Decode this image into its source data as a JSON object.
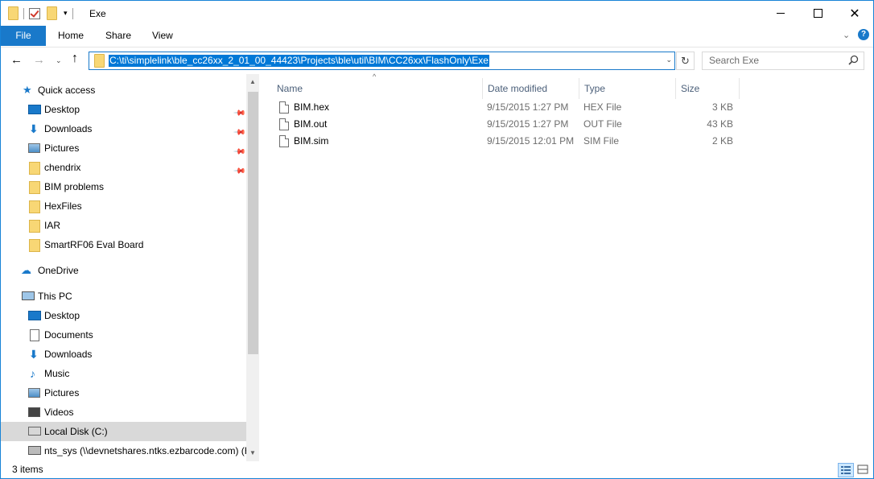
{
  "window": {
    "title": "Exe",
    "qa_dropdown": "▾",
    "min_label": "",
    "close_label": "✕"
  },
  "ribbon": {
    "tabs": [
      {
        "label": "File"
      },
      {
        "label": "Home"
      },
      {
        "label": "Share"
      },
      {
        "label": "View"
      }
    ],
    "collapse_glyph": "⌄",
    "help_glyph": "?"
  },
  "address": {
    "back_glyph": "←",
    "forward_glyph": "→",
    "recent_glyph": "⌄",
    "up_glyph": "↑",
    "path": "C:\\ti\\simplelink\\ble_cc26xx_2_01_00_44423\\Projects\\ble\\util\\BIM\\CC26xx\\FlashOnly\\Exe",
    "dropdown_glyph": "⌄",
    "refresh_glyph": "↻"
  },
  "search": {
    "placeholder": "Search Exe"
  },
  "nav": {
    "pin_glyph": "📌",
    "scroll_up": "▲",
    "scroll_down": "▼",
    "items": [
      {
        "label": "Quick access",
        "icon": "star-icon"
      },
      {
        "label": "Desktop",
        "icon": "desktop-icon",
        "pinned": true
      },
      {
        "label": "Downloads",
        "icon": "download-icon",
        "pinned": true
      },
      {
        "label": "Pictures",
        "icon": "pictures-icon",
        "pinned": true
      },
      {
        "label": "chendrix",
        "icon": "folder-icon",
        "pinned": true
      },
      {
        "label": "BIM problems",
        "icon": "folder-icon"
      },
      {
        "label": "HexFiles",
        "icon": "folder-icon"
      },
      {
        "label": "IAR",
        "icon": "folder-icon"
      },
      {
        "label": "SmartRF06 Eval Board",
        "icon": "folder-icon"
      },
      {
        "label": "OneDrive",
        "icon": "cloud-icon"
      },
      {
        "label": "This PC",
        "icon": "computer-icon"
      },
      {
        "label": "Desktop",
        "icon": "desktop-icon"
      },
      {
        "label": "Documents",
        "icon": "documents-icon"
      },
      {
        "label": "Downloads",
        "icon": "download-icon"
      },
      {
        "label": "Music",
        "icon": "music-icon"
      },
      {
        "label": "Pictures",
        "icon": "pictures-icon"
      },
      {
        "label": "Videos",
        "icon": "videos-icon"
      },
      {
        "label": "Local Disk (C:)",
        "icon": "disk-icon",
        "selected": true
      },
      {
        "label": "nts_sys (\\\\devnetshares.ntks.ezbarcode.com) (H",
        "icon": "network-drive-icon"
      }
    ]
  },
  "files": {
    "sort_glyph": "^",
    "columns": {
      "name": "Name",
      "date": "Date modified",
      "type": "Type",
      "size": "Size"
    },
    "rows": [
      {
        "name": "BIM.hex",
        "date": "9/15/2015 1:27 PM",
        "type": "HEX File",
        "size": "3 KB"
      },
      {
        "name": "BIM.out",
        "date": "9/15/2015 1:27 PM",
        "type": "OUT File",
        "size": "43 KB"
      },
      {
        "name": "BIM.sim",
        "date": "9/15/2015 12:01 PM",
        "type": "SIM File",
        "size": "2 KB"
      }
    ]
  },
  "status": {
    "item_count": "3 items"
  },
  "colors": {
    "accent": "#1979ca",
    "selection": "#0078d7",
    "header_text": "#4c607a"
  }
}
